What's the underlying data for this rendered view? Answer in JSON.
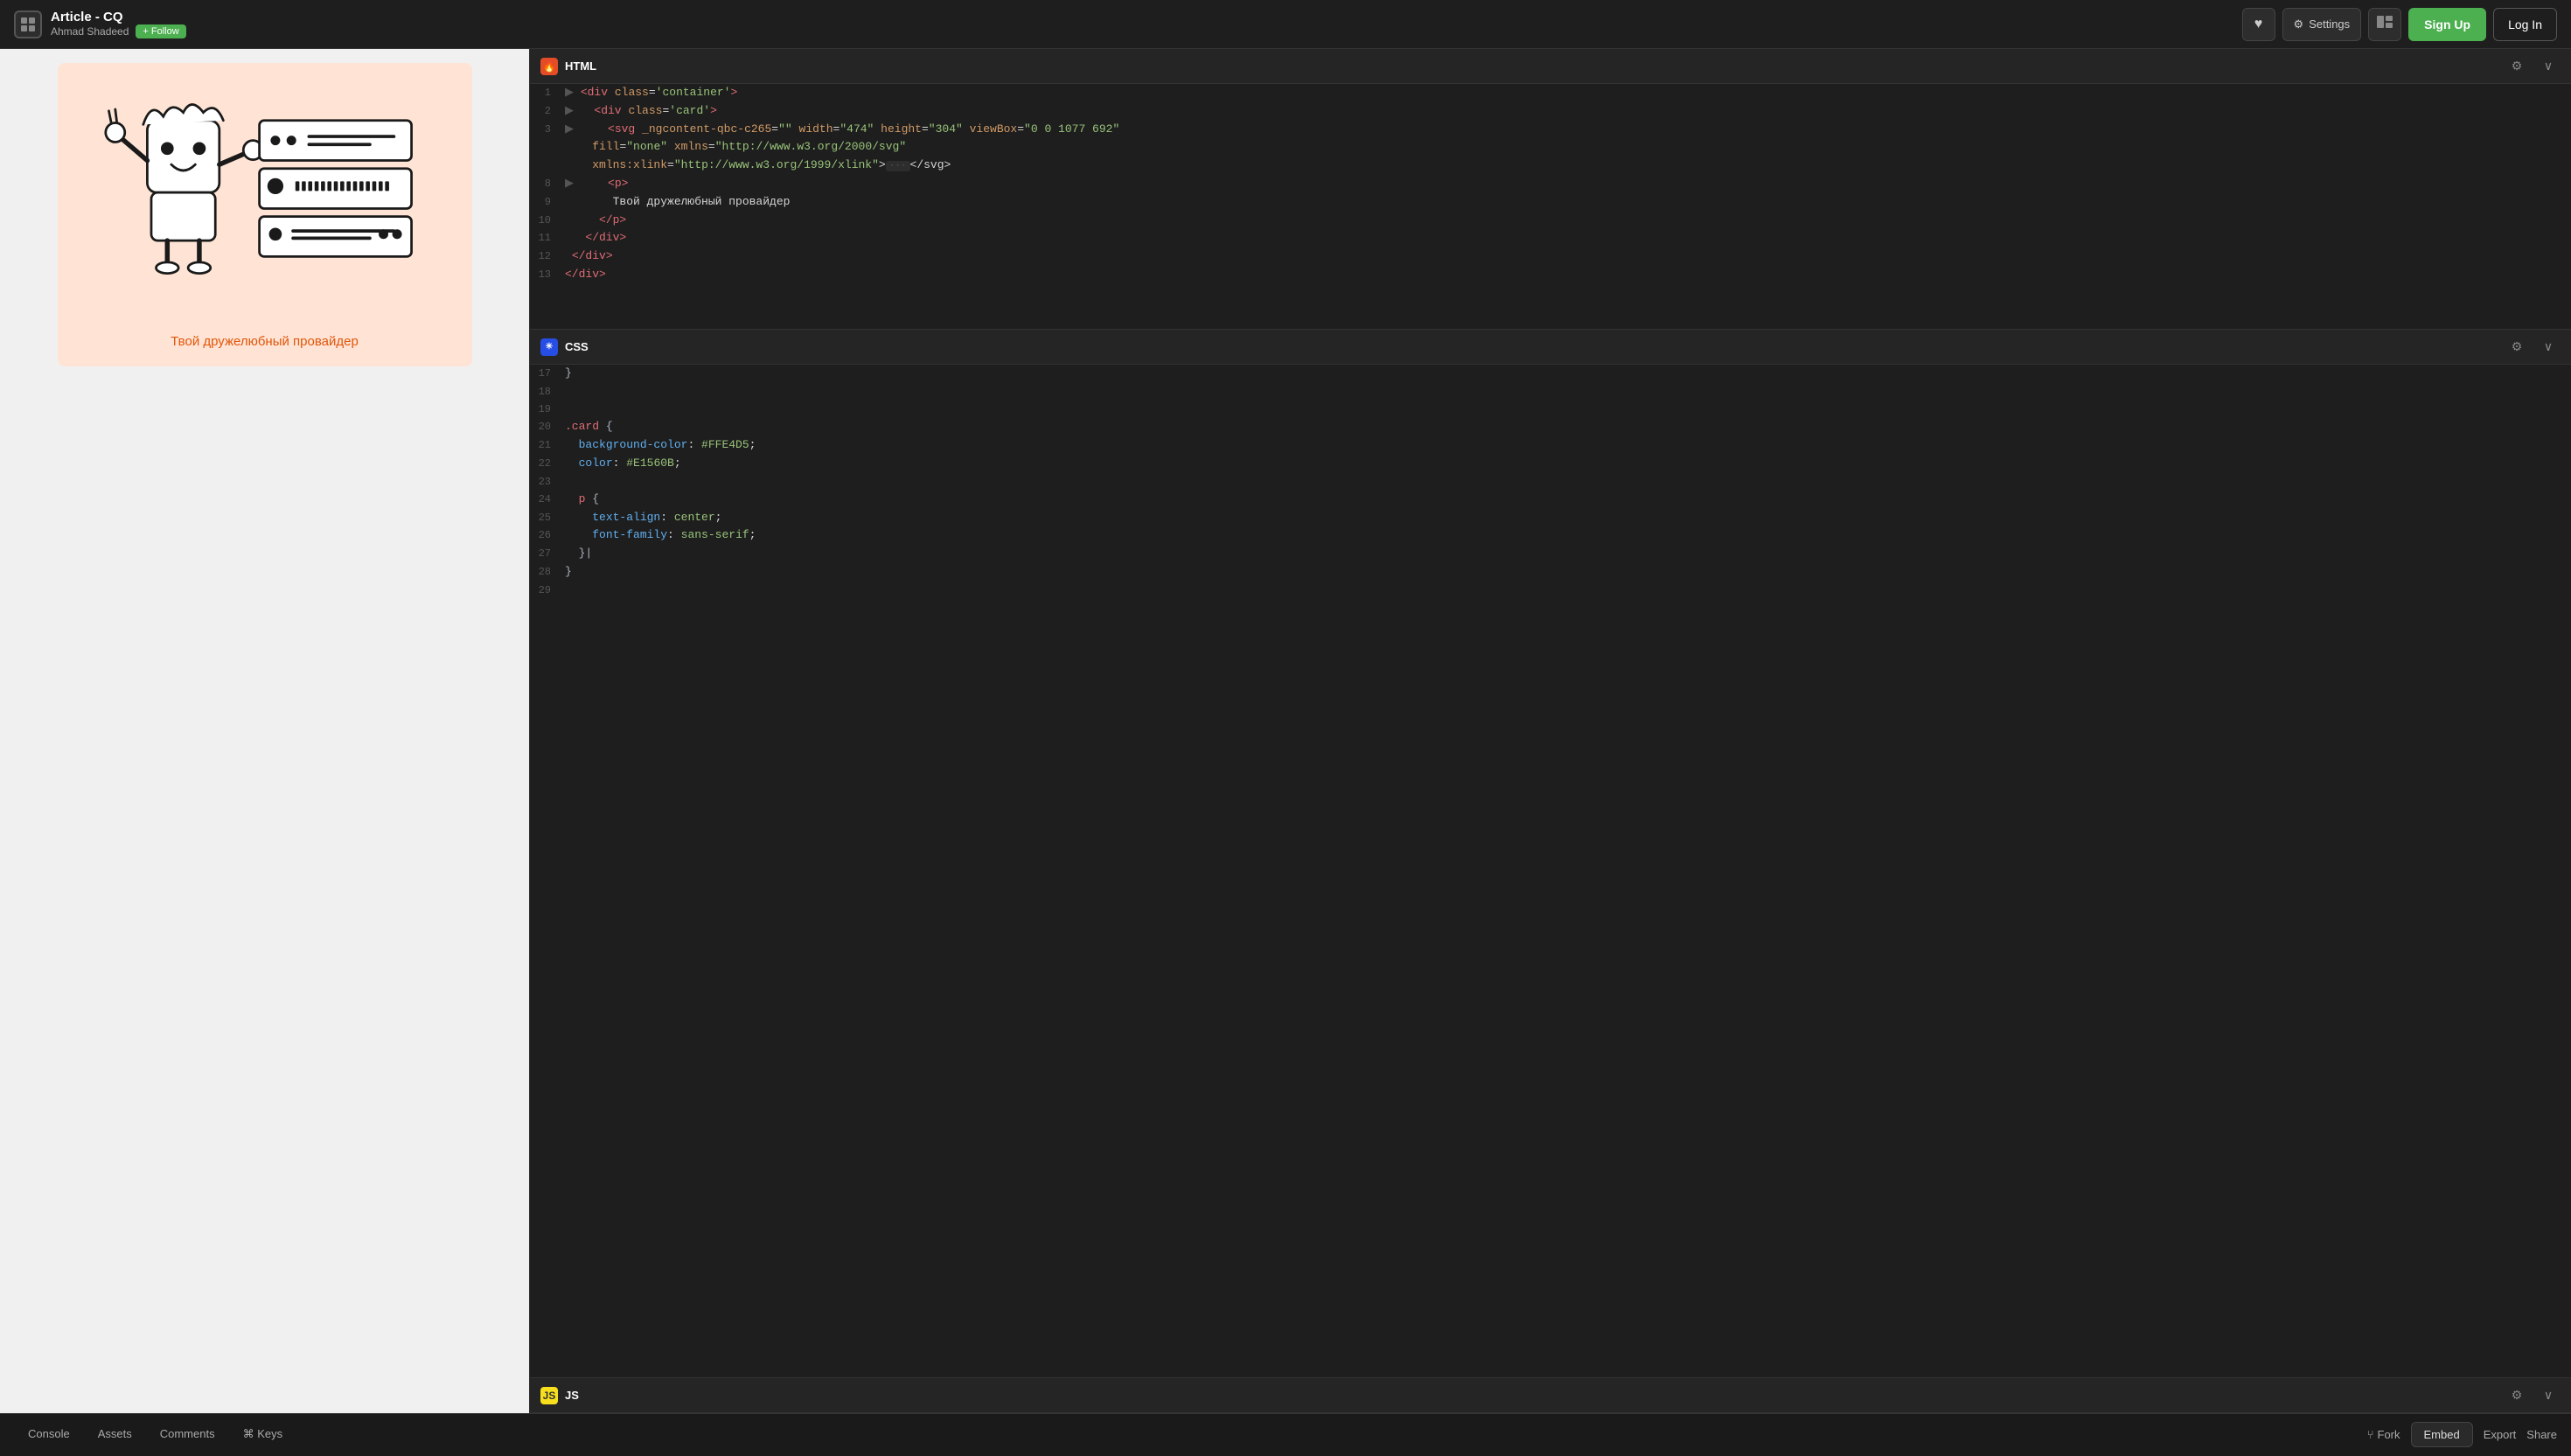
{
  "header": {
    "title": "Article - CQ",
    "author": "Ahmad Shadeed",
    "follow_label": "+ Follow",
    "heart_icon": "♥",
    "settings_label": "Settings",
    "layout_icon": "⊞",
    "signup_label": "Sign Up",
    "login_label": "Log In"
  },
  "preview": {
    "card_text": "Твой дружелюбный провайдер"
  },
  "html_section": {
    "title": "HTML",
    "lines": [
      {
        "num": "1",
        "content": "<div class='container'>",
        "type": "tag"
      },
      {
        "num": "2",
        "content": "  <div class='card'>",
        "type": "tag"
      },
      {
        "num": "3",
        "content": "    <svg _ngcontent-qbc-c265=\"\" width=\"474\" height=\"304\" viewBox=\"0 0 1077 692\"",
        "type": "tag"
      },
      {
        "num": "",
        "content": "    fill=\"none\" xmlns=\"http://www.w3.org/2000/svg\"",
        "type": "attr"
      },
      {
        "num": "",
        "content": "    xmlns:xlink=\"http://www.w3.org/1999/xlink\">···</svg>",
        "type": "mixed"
      },
      {
        "num": "8",
        "content": "      <p>",
        "type": "tag"
      },
      {
        "num": "9",
        "content": "        Твой дружелюбный провайдер",
        "type": "text"
      },
      {
        "num": "10",
        "content": "      </p>",
        "type": "tag"
      },
      {
        "num": "11",
        "content": "    </div>",
        "type": "tag"
      },
      {
        "num": "12",
        "content": "  </div>",
        "type": "tag"
      },
      {
        "num": "13",
        "content": "</div>",
        "type": "tag"
      }
    ]
  },
  "css_section": {
    "title": "CSS",
    "lines": [
      {
        "num": "17",
        "content": "}"
      },
      {
        "num": "18",
        "content": ""
      },
      {
        "num": "19",
        "content": ""
      },
      {
        "num": "20",
        "content": ".card {"
      },
      {
        "num": "21",
        "content": "  background-color: #FFE4D5;"
      },
      {
        "num": "22",
        "content": "  color: #E1560B;"
      },
      {
        "num": "23",
        "content": ""
      },
      {
        "num": "24",
        "content": "  p {"
      },
      {
        "num": "25",
        "content": "    text-align: center;"
      },
      {
        "num": "26",
        "content": "    font-family: sans-serif;"
      },
      {
        "num": "27",
        "content": "  }|"
      },
      {
        "num": "28",
        "content": "}"
      },
      {
        "num": "29",
        "content": ""
      }
    ]
  },
  "js_section": {
    "title": "JS"
  },
  "bottom_bar": {
    "tabs": [
      {
        "label": "Console",
        "active": false,
        "icon": ""
      },
      {
        "label": "Assets",
        "active": false,
        "icon": ""
      },
      {
        "label": "Comments",
        "active": false,
        "icon": ""
      },
      {
        "label": "⌘ Keys",
        "active": false,
        "icon": ""
      }
    ],
    "actions": [
      {
        "label": "Fork",
        "icon": "⑂"
      },
      {
        "label": "Embed",
        "icon": ""
      },
      {
        "label": "Export",
        "icon": ""
      },
      {
        "label": "Share",
        "icon": ""
      }
    ]
  }
}
